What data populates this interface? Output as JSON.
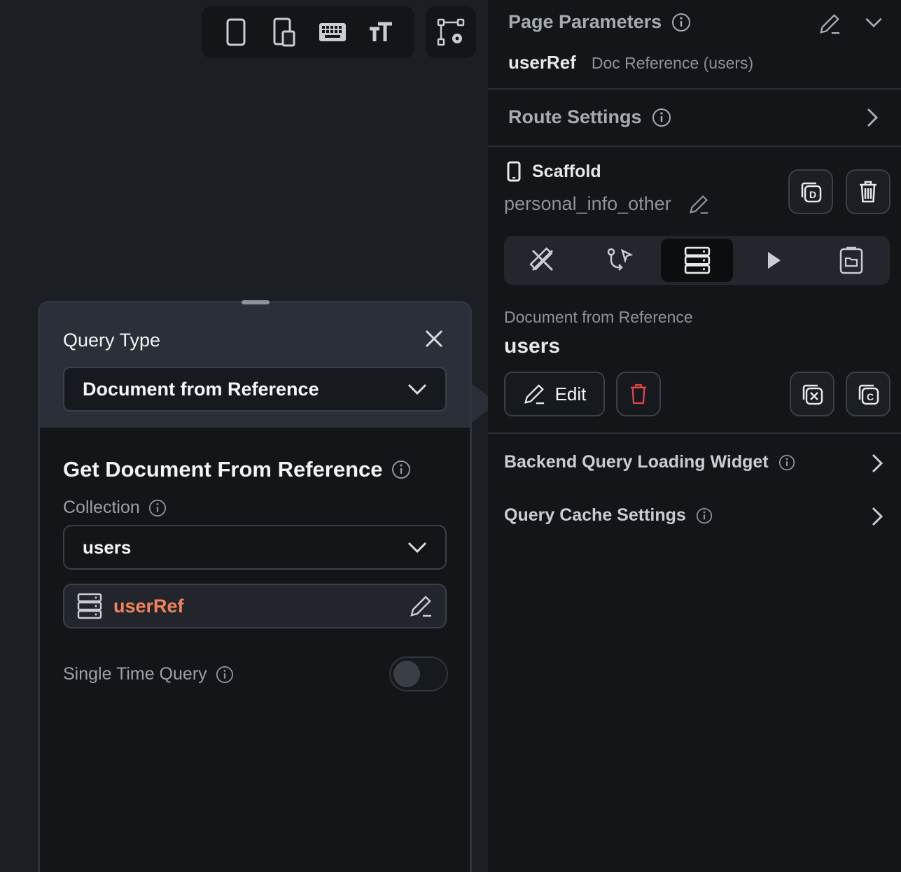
{
  "toolbar": {
    "buttons": [
      {
        "icon": "phone-icon"
      },
      {
        "icon": "tablet-icon"
      },
      {
        "icon": "keyboard-icon"
      },
      {
        "icon": "text-size-icon"
      }
    ],
    "extra_button": {
      "icon": "widget-tree-settings-icon"
    }
  },
  "query_panel": {
    "title": "Query Type",
    "query_type_value": "Document from Reference",
    "section_title": "Get Document From Reference",
    "collection_label": "Collection",
    "collection_value": "users",
    "reference_value": "userRef",
    "single_time_label": "Single Time Query",
    "single_time_enabled": false
  },
  "side_panel": {
    "page_parameters": {
      "title": "Page Parameters",
      "param_name": "userRef",
      "param_type": "Doc Reference (users)"
    },
    "route_settings": {
      "title": "Route Settings"
    },
    "widget": {
      "type": "Scaffold",
      "name": "personal_info_other"
    },
    "tabs": [
      {
        "icon": "design-tools-icon",
        "active": false
      },
      {
        "icon": "actions-flow-icon",
        "active": false
      },
      {
        "icon": "backend-query-icon",
        "active": true
      },
      {
        "icon": "play-icon",
        "active": false
      },
      {
        "icon": "folder-icon",
        "active": false
      }
    ],
    "query": {
      "type_label": "Document from Reference",
      "collection": "users",
      "edit_label": "Edit"
    },
    "loading_widget": {
      "title": "Backend Query Loading Widget"
    },
    "cache_settings": {
      "title": "Query Cache Settings"
    }
  },
  "colors": {
    "accent_orange": "#f2835a",
    "delete_red": "#e0454a",
    "background": "#1b1e22",
    "panel": "#131518"
  }
}
